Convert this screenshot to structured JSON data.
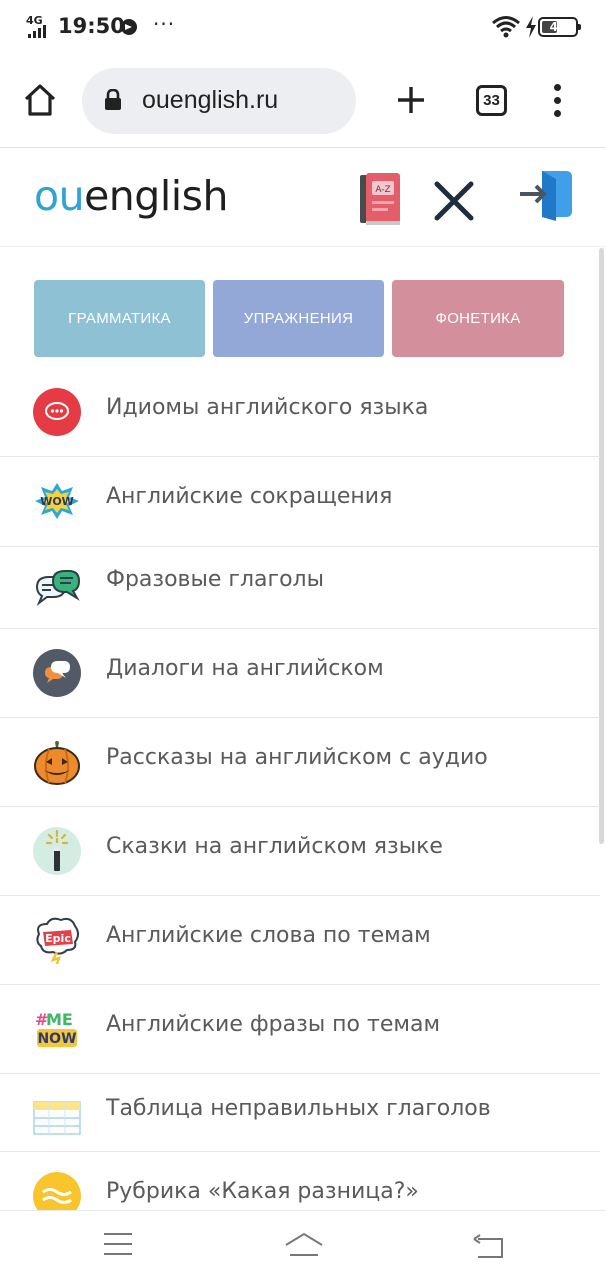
{
  "status_bar": {
    "network": "4G",
    "time": "19:50",
    "more": "···",
    "battery": "48",
    "battery_level": 0.48
  },
  "browser": {
    "url": "ouenglish.ru",
    "tabs_count": "33",
    "icons": [
      "home-icon",
      "lock-icon",
      "plus-icon",
      "tabs-icon",
      "more-vert-icon"
    ]
  },
  "site": {
    "logo_accent": "ou",
    "logo_rest": "english",
    "colors": {
      "accent": "#2ea3d5"
    }
  },
  "categories": [
    {
      "label": "ГРАММАТИКА",
      "color": "#8fc1d4"
    },
    {
      "label": "УПРАЖНЕНИЯ",
      "color": "#93a8d7"
    },
    {
      "label": "ФОНЕТИКА",
      "color": "#d48f9d"
    }
  ],
  "menu_items": [
    {
      "label": "Идиомы английского языка",
      "icon": "chat-bubble-icon"
    },
    {
      "label": "Английские сокращения",
      "icon": "wow-icon"
    },
    {
      "label": "Фразовые глаголы",
      "icon": "speech-bubbles-icon"
    },
    {
      "label": "Диалоги на английском",
      "icon": "dialog-icon"
    },
    {
      "label": "Рассказы на английском с аудио",
      "icon": "pumpkin-icon"
    },
    {
      "label": "Сказки на английском языке",
      "icon": "magic-wand-icon"
    },
    {
      "label": "Английские слова по темам",
      "icon": "epic-icon"
    },
    {
      "label": "Английские фразы по темам",
      "icon": "me-now-icon"
    },
    {
      "label": "Таблица неправильных глаголов",
      "icon": "table-icon"
    },
    {
      "label": "Рубрика «Какая разница?»",
      "icon": "waves-icon"
    }
  ],
  "nav_bar": {
    "icons": [
      "recent-apps-icon",
      "home-icon",
      "back-icon"
    ]
  }
}
